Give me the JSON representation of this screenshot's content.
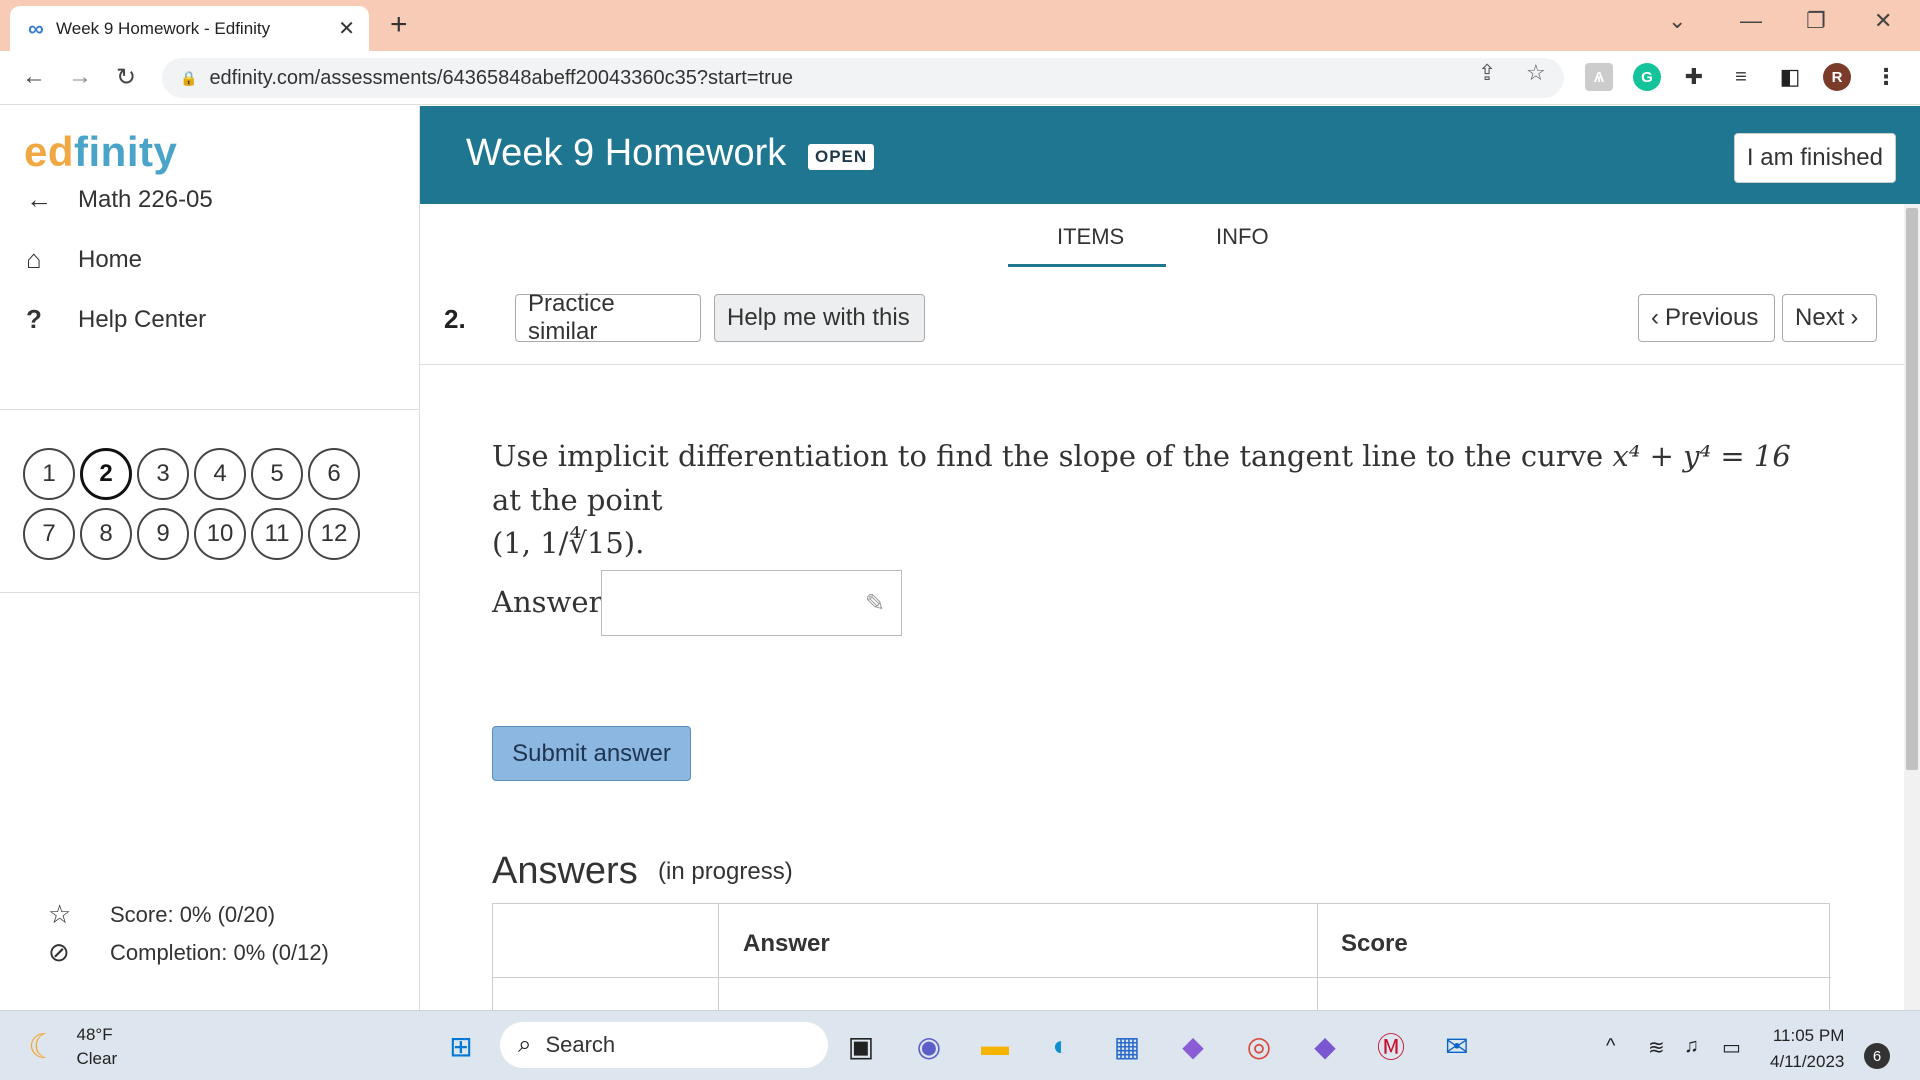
{
  "browser": {
    "tab_title": "Week 9 Homework - Edfinity",
    "url": "edfinity.com/assessments/64365848abeff20043360c35?start=true",
    "profile_initial": "R"
  },
  "sidebar": {
    "logo_ed": "ed",
    "logo_finity": "finity",
    "nav": {
      "course": "Math 226-05",
      "home": "Home",
      "help": "Help Center"
    },
    "questions": [
      "1",
      "2",
      "3",
      "4",
      "5",
      "6",
      "7",
      "8",
      "9",
      "10",
      "11",
      "12"
    ],
    "active_question": "2",
    "score": "Score: 0% (0/20)",
    "completion": "Completion: 0% (0/12)"
  },
  "header": {
    "title": "Week 9 Homework",
    "badge": "OPEN",
    "finish_label": "I am finished"
  },
  "tabs": {
    "items": "ITEMS",
    "info": "INFO"
  },
  "question_bar": {
    "number": "2.",
    "practice": "Practice similar",
    "help": "Help me with this",
    "previous": "Previous",
    "next": "Next"
  },
  "problem": {
    "text_before": "Use implicit differentiation to find the slope of the tangent line to the curve",
    "equation": "x⁴ + y⁴ = 16",
    "text_mid": "at the point",
    "point": "(1, 1/∜15)."
  },
  "answer": {
    "label": "Answer:",
    "value": "",
    "submit_label": "Submit answer"
  },
  "answers_section": {
    "heading": "Answers",
    "status": "(in progress)",
    "columns": [
      "",
      "Answer",
      "Score"
    ]
  },
  "taskbar": {
    "temp": "48°F",
    "condition": "Clear",
    "search_placeholder": "Search",
    "time": "11:05 PM",
    "date": "4/11/2023",
    "notifications": "6"
  }
}
